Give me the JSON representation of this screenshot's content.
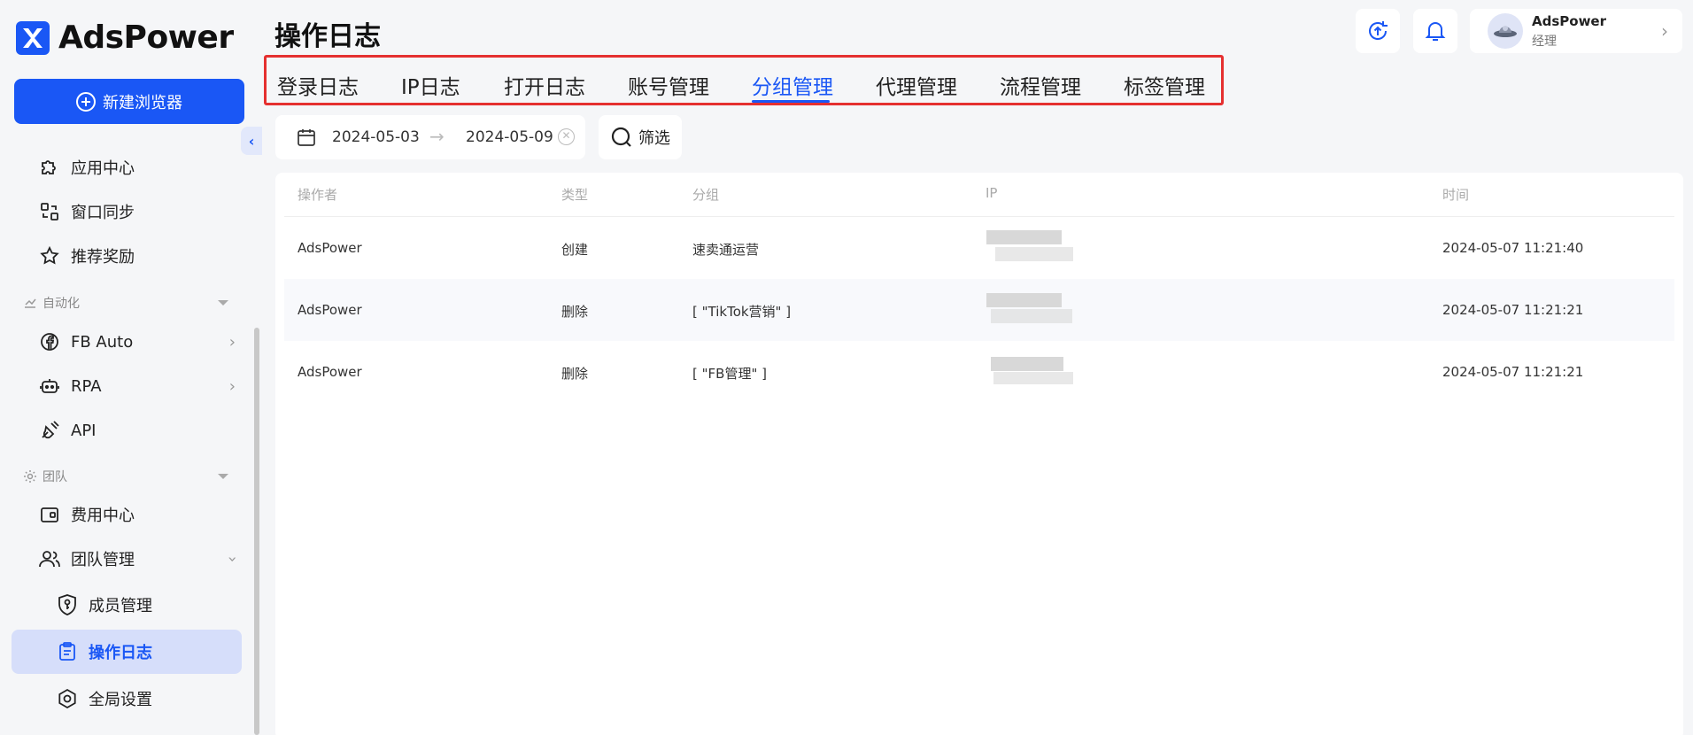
{
  "app": {
    "name": "AdsPower"
  },
  "sidebar": {
    "new_browser_label": "新建浏览器",
    "items": [
      {
        "label": "应用中心",
        "icon": "puzzle-icon"
      },
      {
        "label": "窗口同步",
        "icon": "window-sync-icon"
      },
      {
        "label": "推荐奖励",
        "icon": "star-icon"
      }
    ],
    "section_automation": "自动化",
    "automation_items": [
      {
        "label": "FB Auto",
        "icon": "facebook-icon"
      },
      {
        "label": "RPA",
        "icon": "robot-icon"
      },
      {
        "label": "API",
        "icon": "plug-icon"
      }
    ],
    "section_team": "团队",
    "team_items": [
      {
        "label": "费用中心",
        "icon": "wallet-icon"
      },
      {
        "label": "团队管理",
        "icon": "team-icon"
      }
    ],
    "team_sub_items": [
      {
        "label": "成员管理",
        "icon": "shield-key-icon"
      },
      {
        "label": "操作日志",
        "icon": "clipboard-icon",
        "active": true
      },
      {
        "label": "全局设置",
        "icon": "hexagon-gear-icon"
      }
    ]
  },
  "header": {
    "title": "操作日志",
    "user": {
      "name": "AdsPower",
      "role": "经理"
    }
  },
  "tabs": [
    {
      "label": "登录日志"
    },
    {
      "label": "IP日志"
    },
    {
      "label": "打开日志"
    },
    {
      "label": "账号管理"
    },
    {
      "label": "分组管理",
      "active": true
    },
    {
      "label": "代理管理"
    },
    {
      "label": "流程管理"
    },
    {
      "label": "标签管理"
    }
  ],
  "filters": {
    "date_start": "2024-05-03",
    "date_end": "2024-05-09",
    "filter_label": "筛选"
  },
  "table": {
    "columns": [
      "操作者",
      "类型",
      "分组",
      "IP",
      "时间"
    ],
    "rows": [
      {
        "operator": "AdsPower",
        "type": "创建",
        "group": "速卖通运营",
        "time": "2024-05-07 11:21:40"
      },
      {
        "operator": "AdsPower",
        "type": "删除",
        "group": "[ \"TikTok营销\" ]",
        "time": "2024-05-07 11:21:21"
      },
      {
        "operator": "AdsPower",
        "type": "删除",
        "group": "[ \"FB管理\" ]",
        "time": "2024-05-07 11:21:21"
      }
    ]
  },
  "colors": {
    "accent": "#1a57f5",
    "highlight_border": "#e53030",
    "active_bg": "#d6defa"
  }
}
